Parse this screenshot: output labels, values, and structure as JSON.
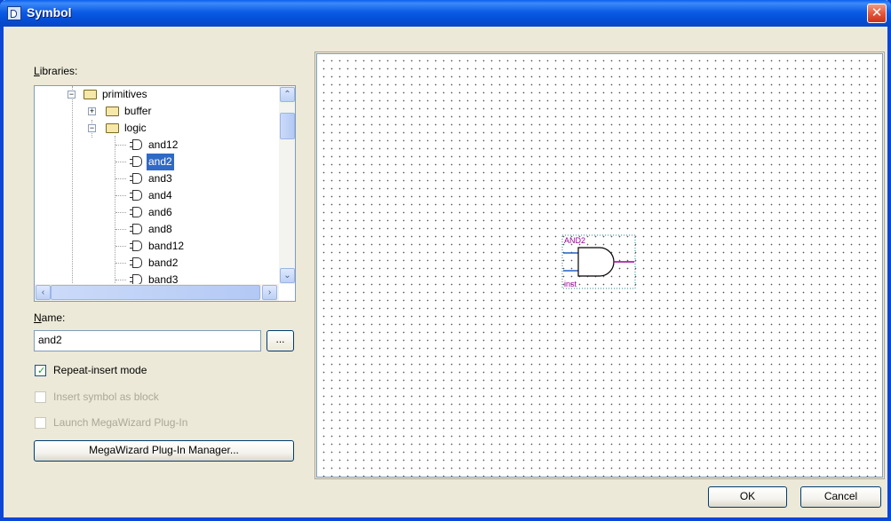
{
  "window": {
    "title": "Symbol",
    "close_glyph": "✕"
  },
  "libraries": {
    "label": "Libraries:",
    "tree": [
      {
        "label": "primitives",
        "expander": "−",
        "type": "folder"
      },
      {
        "label": "buffer",
        "expander": "+",
        "type": "folder"
      },
      {
        "label": "logic",
        "expander": "−",
        "type": "folder"
      },
      {
        "label": "and12",
        "type": "symbol"
      },
      {
        "label": "and2",
        "type": "symbol",
        "selected": true
      },
      {
        "label": "and3",
        "type": "symbol"
      },
      {
        "label": "and4",
        "type": "symbol"
      },
      {
        "label": "and6",
        "type": "symbol"
      },
      {
        "label": "and8",
        "type": "symbol"
      },
      {
        "label": "band12",
        "type": "symbol"
      },
      {
        "label": "band2",
        "type": "symbol"
      },
      {
        "label": "band3",
        "type": "symbol"
      }
    ],
    "scroll_glyphs": {
      "up": "⌃",
      "down": "⌄",
      "left": "‹",
      "right": "›"
    }
  },
  "name": {
    "label": "Name:",
    "value": "and2",
    "browse_label": "..."
  },
  "options": {
    "repeat_insert": {
      "label": "Repeat-insert mode",
      "checked": true,
      "enabled": true
    },
    "insert_as_block": {
      "label": "Insert symbol as block",
      "checked": false,
      "enabled": false
    },
    "launch_megawizard": {
      "label": "Launch MegaWizard Plug-In",
      "checked": false,
      "enabled": false
    }
  },
  "megawizard_button": "MegaWizard Plug-In Manager...",
  "preview": {
    "symbol_name": "AND2",
    "instance_label": "inst",
    "accent": "#9a009a",
    "pin_color": "#2060c0"
  },
  "buttons": {
    "ok": "OK",
    "cancel": "Cancel"
  }
}
